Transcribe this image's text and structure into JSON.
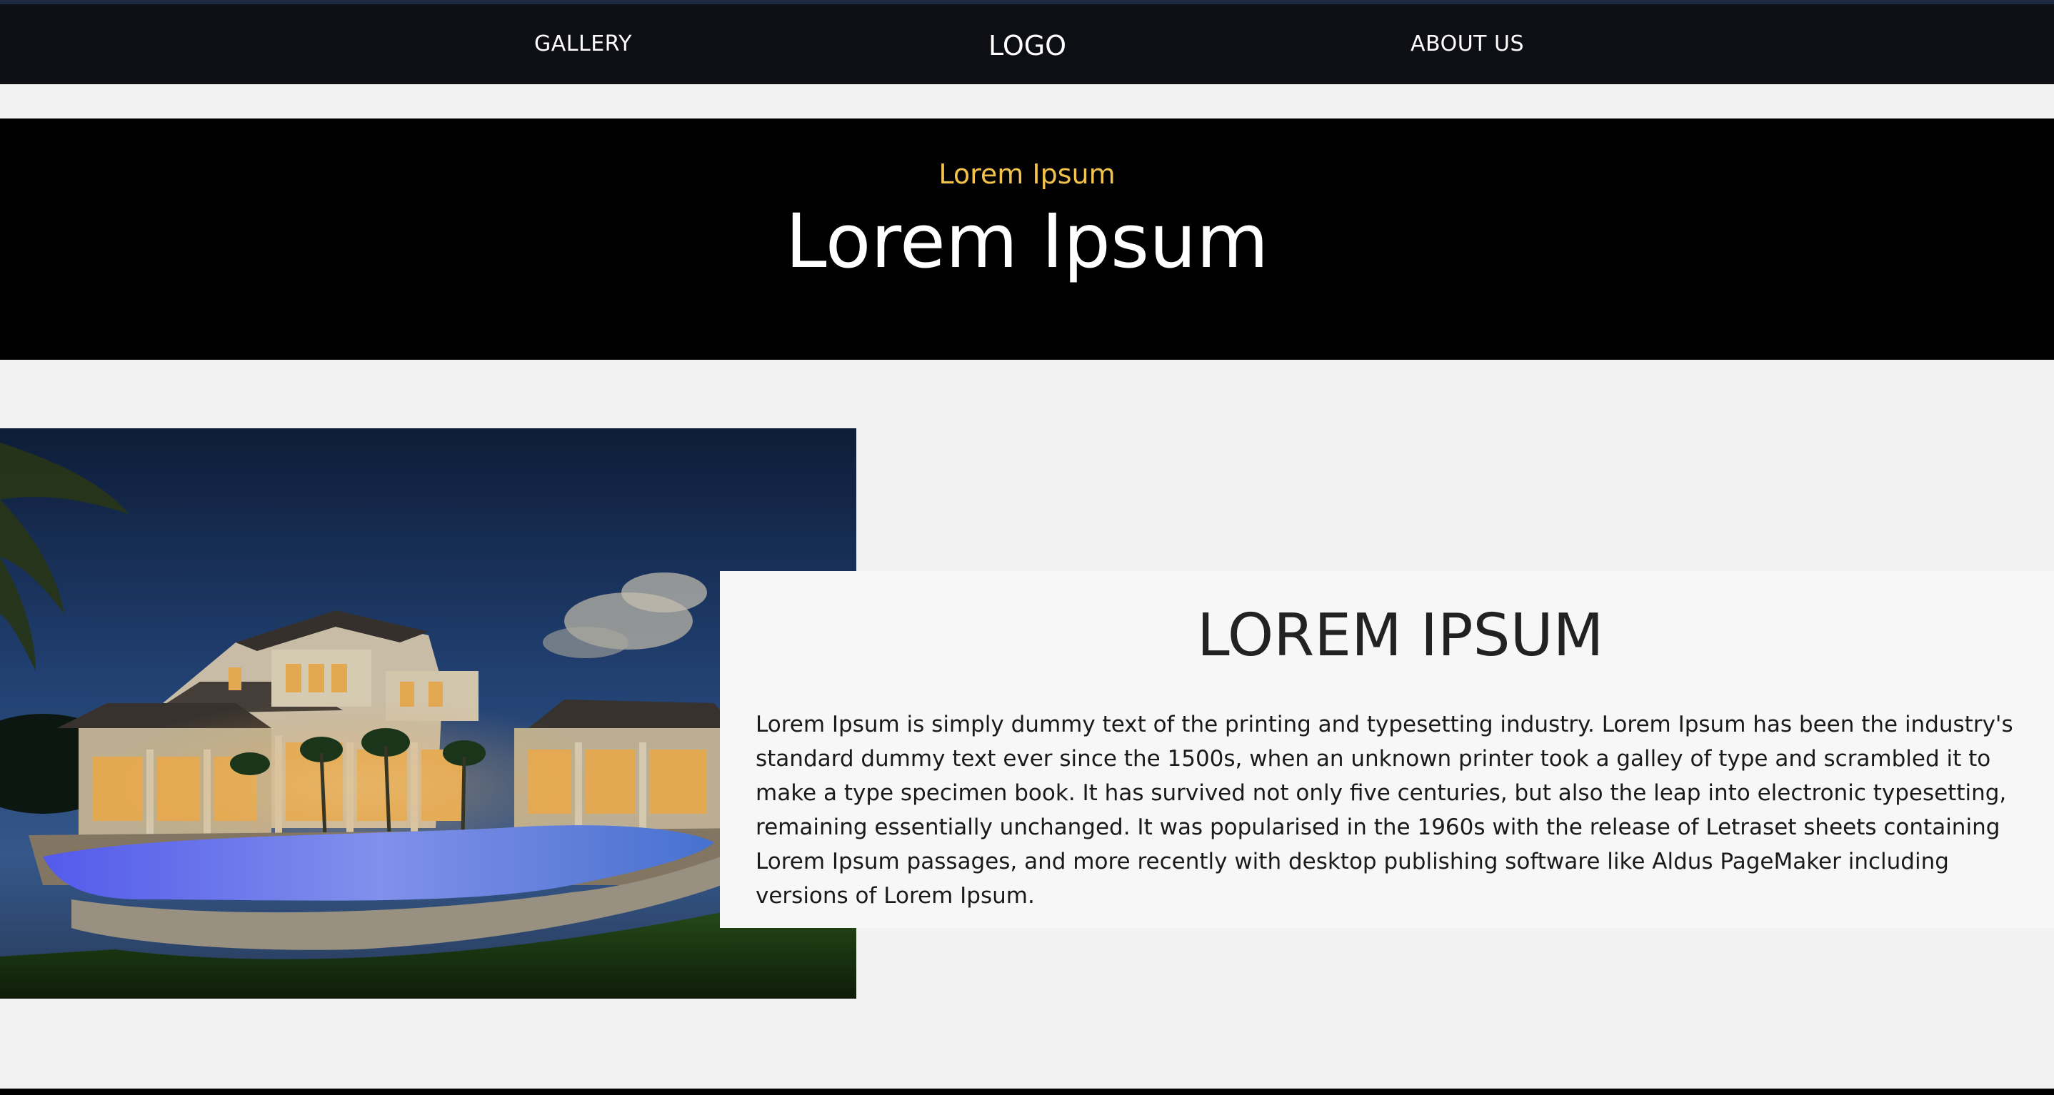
{
  "nav": {
    "left_link": "GALLERY",
    "logo": "LOGO",
    "right_link": "ABOUT US"
  },
  "hero": {
    "subtitle": "Lorem Ipsum",
    "title": "Lorem Ipsum"
  },
  "feature": {
    "image_subject": "luxury villa with illuminated pool at dusk",
    "title": "LOREM IPSUM",
    "body": "Lorem Ipsum is simply dummy text of the printing and typesetting industry. Lorem Ipsum has been the industry's standard dummy text ever since the 1500s, when an unknown printer took a galley of type and scrambled it to make a type specimen book. It has survived not only five centuries, but also the leap into electronic typesetting, remaining essentially unchanged. It was popularised in the 1960s with the release of Letraset sheets containing Lorem Ipsum passages, and more recently with desktop publishing software like Aldus PageMaker including versions of Lorem Ipsum."
  },
  "colors": {
    "navbar": "#0e0f15",
    "hero_bg": "#000000",
    "hero_accent": "#f2c24d",
    "page_bg": "#f2f2f2",
    "card_bg": "#f7f7f7"
  }
}
